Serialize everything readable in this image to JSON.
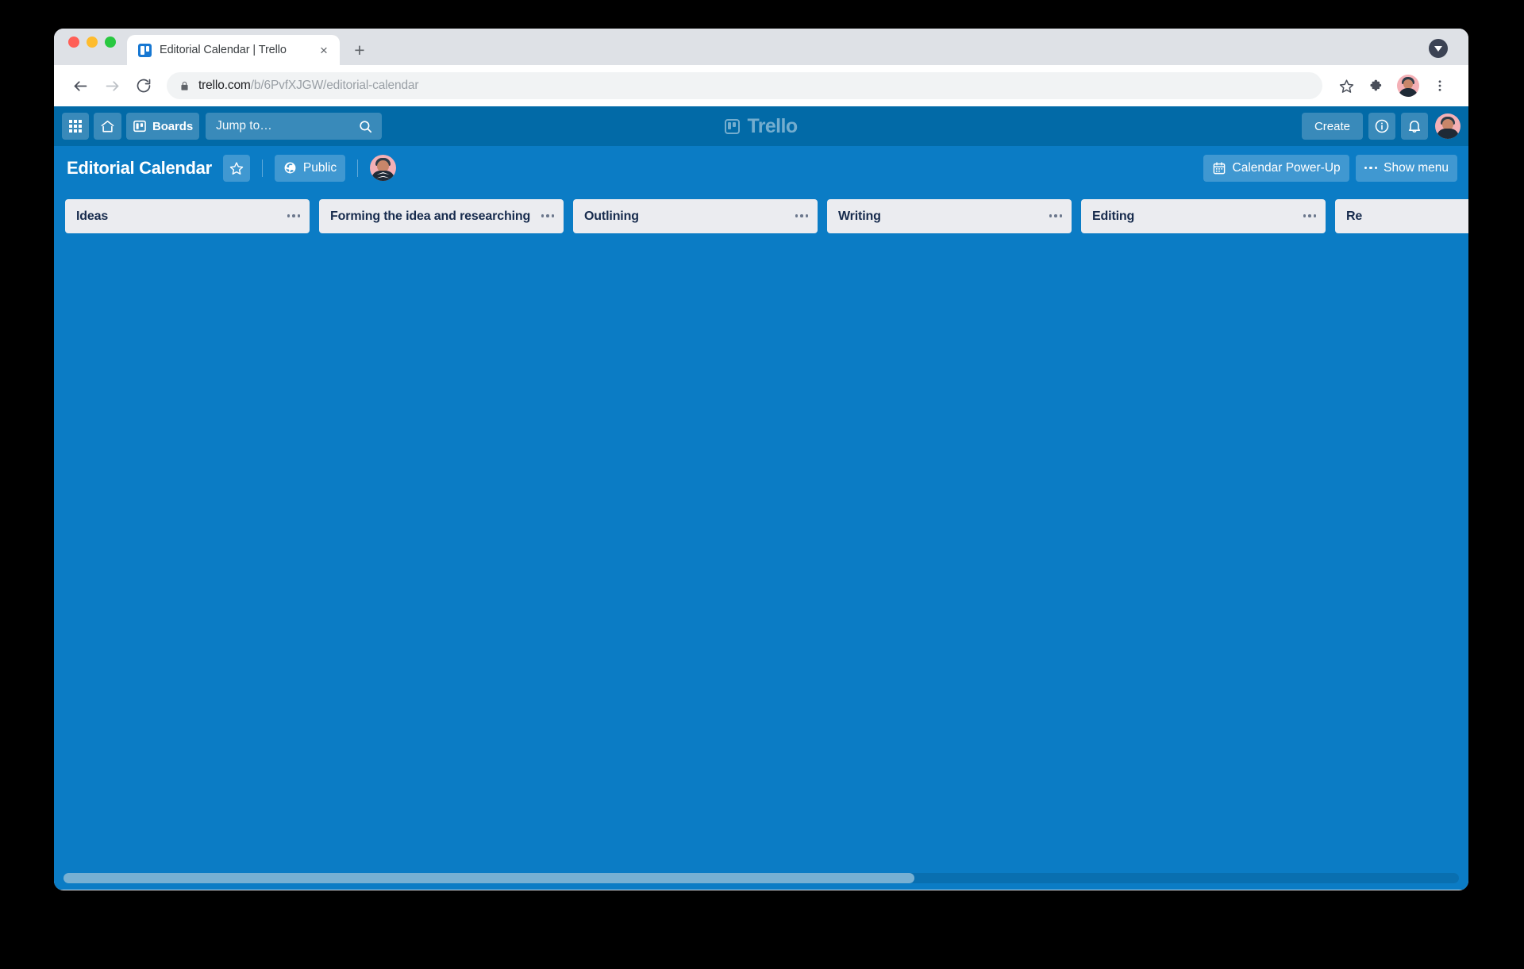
{
  "browser": {
    "tab": {
      "title": "Editorial Calendar | Trello",
      "favicon_name": "trello-favicon",
      "close_label": "×",
      "new_tab_label": "+"
    },
    "toolbar": {
      "back_icon": "back-arrow-icon",
      "forward_icon": "forward-arrow-icon",
      "reload_icon": "reload-icon",
      "lock_icon": "lock-icon",
      "url_host": "trello.com",
      "url_path": "/b/6PvfXJGW/editorial-calendar",
      "bookmark_icon": "star-outline-icon",
      "extensions_icon": "puzzle-piece-icon",
      "profile_icon": "profile-avatar",
      "menu_icon": "three-dots-vertical-icon"
    },
    "window_controls": {
      "close": "close-window-button",
      "minimize": "minimize-window-button",
      "maximize": "maximize-window-button",
      "download_indicator": "download-indicator"
    }
  },
  "trello_topnav": {
    "apps_icon": "grid-apps-icon",
    "home_icon": "home-icon",
    "boards_label": "Boards",
    "boards_icon": "board-icon",
    "search": {
      "placeholder": "Jump to…",
      "icon": "search-icon"
    },
    "logo_text": "Trello",
    "create_label": "Create",
    "info_icon": "info-circle-icon",
    "notifications_icon": "bell-icon",
    "avatar_name": "user-avatar"
  },
  "board_header": {
    "title": "Editorial Calendar",
    "star_icon": "star-outline-icon",
    "visibility_label": "Public",
    "visibility_icon": "globe-icon",
    "member_avatar_name": "board-member-avatar",
    "power_up_label": "Calendar Power-Up",
    "power_up_icon": "calendar-icon",
    "show_menu_label": "Show menu",
    "show_menu_icon": "dots-horizontal-icon"
  },
  "board": {
    "lists": [
      {
        "title": "Ideas",
        "menu_icon": "dots-horizontal-icon",
        "clipped": false
      },
      {
        "title": "Forming the idea and researching",
        "menu_icon": "dots-horizontal-icon",
        "clipped": false
      },
      {
        "title": "Outlining",
        "menu_icon": "dots-horizontal-icon",
        "clipped": false
      },
      {
        "title": "Writing",
        "menu_icon": "dots-horizontal-icon",
        "clipped": false
      },
      {
        "title": "Editing",
        "menu_icon": "dots-horizontal-icon",
        "clipped": false
      },
      {
        "title": "Re",
        "menu_icon": "dots-horizontal-icon",
        "clipped": true
      }
    ],
    "scrollbar": {
      "thumb_percent": 61
    }
  },
  "colors": {
    "trello_nav_blue": "#026aa7",
    "board_blue": "#0b7cc5",
    "list_grey": "#ebecf0",
    "list_text": "#172b4d",
    "avatar_pink": "#f4b0b6"
  }
}
